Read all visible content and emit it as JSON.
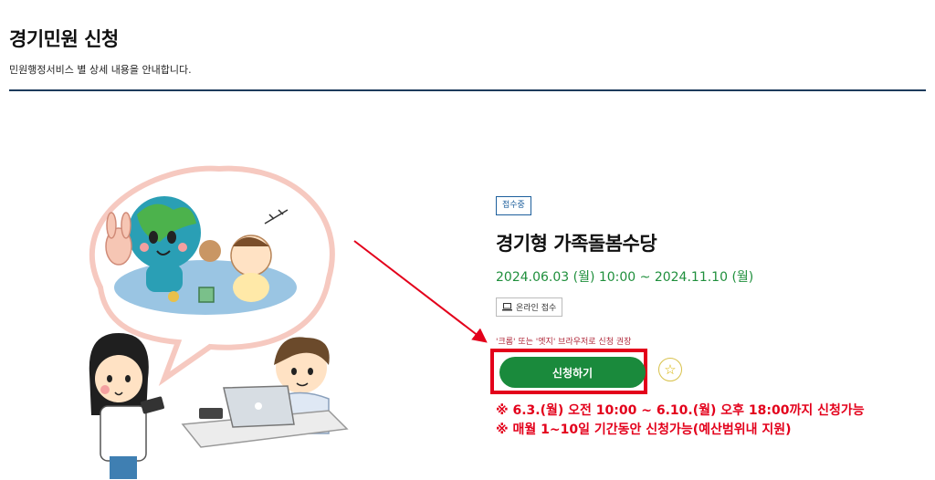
{
  "header": {
    "title": "경기민원 신청",
    "description": "민원행정서비스 별 상세 내용을 안내합니다."
  },
  "service": {
    "status_badge": "접수중",
    "title": "경기형 가족돌봄수당",
    "period": "2024.06.03 (월) 10:00 ~ 2024.11.10 (월)",
    "channel_label": "온라인 접수",
    "browser_note": "'크롬' 또는 '엣지' 브라우저로 신청 권장",
    "apply_label": "신청하기",
    "favorite_icon": "star-icon",
    "notices": [
      "※ 6.3.(월) 오전 10:00 ~ 6.10.(월) 오후 18:00까지 신청가능",
      "※ 매월 1~10일 기간동안 신청가능(예산범위내 지원)"
    ]
  },
  "colors": {
    "accent_green": "#1a8a3c",
    "period_green": "#1f8f3c",
    "notice_red": "#e3001b",
    "header_line": "#1d3a5c",
    "badge_blue": "#1d5f9c"
  }
}
